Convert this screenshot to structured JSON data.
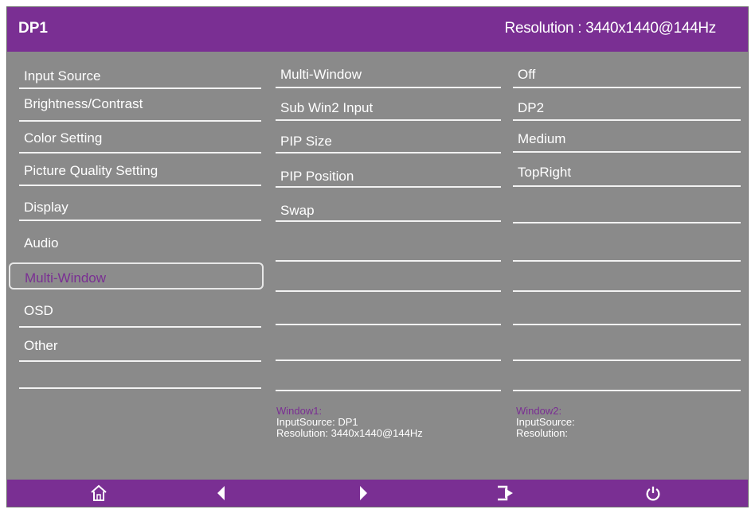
{
  "header": {
    "title": "DP1",
    "resolution": "Resolution : 3440x1440@144Hz"
  },
  "menu": {
    "items": [
      {
        "label": "Input Source"
      },
      {
        "label": "Brightness/Contrast"
      },
      {
        "label": "Color Setting"
      },
      {
        "label": "Picture Quality Setting"
      },
      {
        "label": "Display"
      },
      {
        "label": "Audio"
      },
      {
        "label": "Multi-Window"
      },
      {
        "label": "OSD"
      },
      {
        "label": "Other"
      }
    ],
    "selected": "Multi-Window"
  },
  "submenu": {
    "items": [
      {
        "label": "Multi-Window",
        "value": "Off"
      },
      {
        "label": "Sub Win2 Input",
        "value": "DP2"
      },
      {
        "label": "PIP Size",
        "value": "Medium"
      },
      {
        "label": "PIP Position",
        "value": "TopRight"
      },
      {
        "label": "Swap",
        "value": ""
      }
    ]
  },
  "window_info": {
    "window1": {
      "label": "Window1:",
      "input_source": "InputSource: DP1",
      "resolution": "Resolution: 3440x1440@144Hz"
    },
    "window2": {
      "label": "Window2:",
      "input_source": "InputSource:",
      "resolution": "Resolution:"
    }
  },
  "footer": {
    "buttons": [
      {
        "icon": "home-icon"
      },
      {
        "icon": "left-arrow-icon"
      },
      {
        "icon": "right-arrow-icon"
      },
      {
        "icon": "exit-icon"
      },
      {
        "icon": "power-icon"
      }
    ]
  },
  "colors": {
    "accent": "#7a2f93",
    "panel": "#8a8a8a",
    "text": "#ffffff"
  }
}
